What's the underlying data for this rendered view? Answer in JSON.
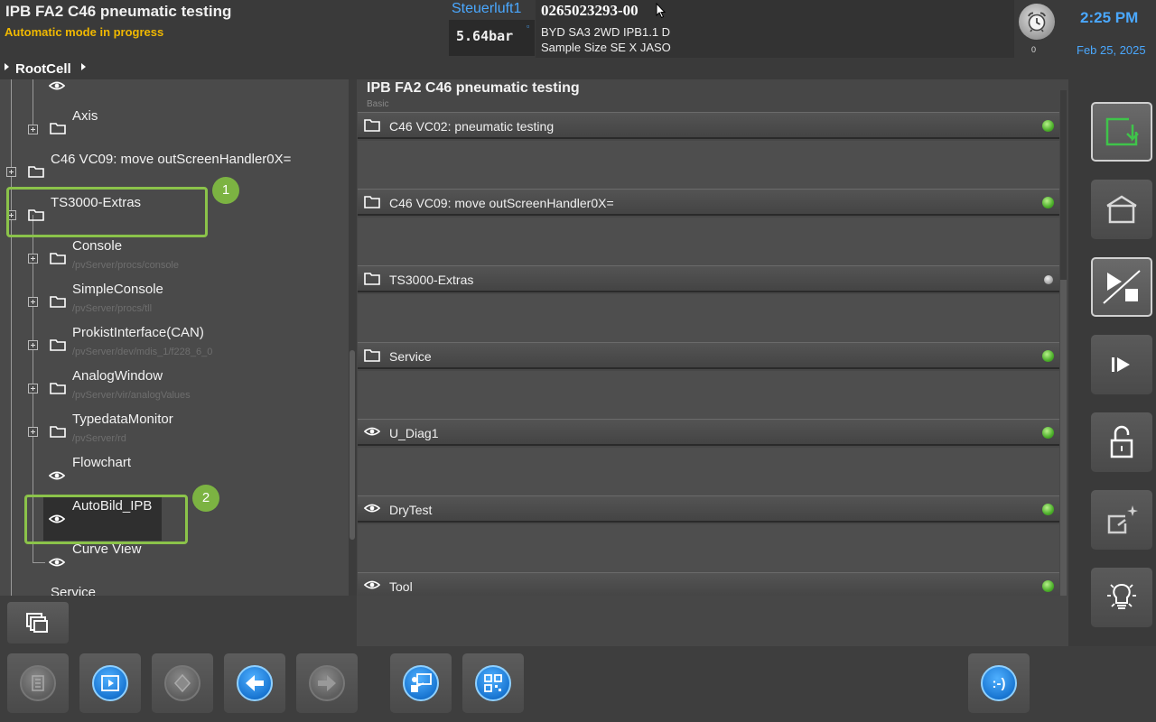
{
  "header": {
    "title": "IPB FA2 C46 pneumatic testing",
    "status": "Automatic mode in progress",
    "pressure_label": "Steuerluft1",
    "pressure_value": "5.64bar",
    "part_number": "0265023293-00",
    "part_line1": "BYD SA3 2WD IPB1.1 D",
    "part_line2": "Sample Size SE  X JASO",
    "alarm_count": "0",
    "time": "2:25 PM",
    "date": "Feb 25, 2025"
  },
  "breadcrumb": {
    "label": "RootCell"
  },
  "tree": {
    "items": [
      {
        "label": "Axis",
        "path": ""
      },
      {
        "label": "C46 VC09: move outScreenHandler0X=",
        "path": ""
      },
      {
        "label": "TS3000-Extras",
        "path": ""
      },
      {
        "label": "Console",
        "path": "/pvServer/procs/console"
      },
      {
        "label": "SimpleConsole",
        "path": "/pvServer/procs/tll"
      },
      {
        "label": "ProkistInterface(CAN)",
        "path": "/pvServer/dev/mdis_1/f228_6_0"
      },
      {
        "label": "AnalogWindow",
        "path": "/pvServer/vir/analogValues"
      },
      {
        "label": "TypedataMonitor",
        "path": "/pvServer/rd"
      },
      {
        "label": "Flowchart",
        "path": ""
      },
      {
        "label": "AutoBild_IPB",
        "path": ""
      },
      {
        "label": "Curve View",
        "path": ""
      },
      {
        "label": "Service",
        "path": ""
      }
    ],
    "callouts": [
      "1",
      "2"
    ]
  },
  "main": {
    "title": "IPB FA2 C46 pneumatic testing",
    "subtitle": "Basic",
    "groups": [
      {
        "label": "C46 VC02: pneumatic testing",
        "icon": "folder-icon",
        "status": "ok"
      },
      {
        "label": "C46 VC09: move outScreenHandler0X=",
        "icon": "folder-icon",
        "status": "ok"
      },
      {
        "label": "TS3000-Extras",
        "icon": "folder-icon",
        "status": "idle"
      },
      {
        "label": "Service",
        "icon": "folder-icon",
        "status": "ok"
      },
      {
        "label": "U_Diag1",
        "icon": "eye-icon",
        "status": "ok"
      },
      {
        "label": "DryTest",
        "icon": "eye-icon",
        "status": "ok"
      },
      {
        "label": "Tool",
        "icon": "eye-icon",
        "status": "ok"
      }
    ]
  },
  "bottom": {
    "smiley_label": ":-)"
  },
  "colors": {
    "accent_blue": "#4aa8ff",
    "status_yellow": "#f0b800",
    "callout_green": "#8bc34a",
    "ok_green": "#4caf2a"
  }
}
